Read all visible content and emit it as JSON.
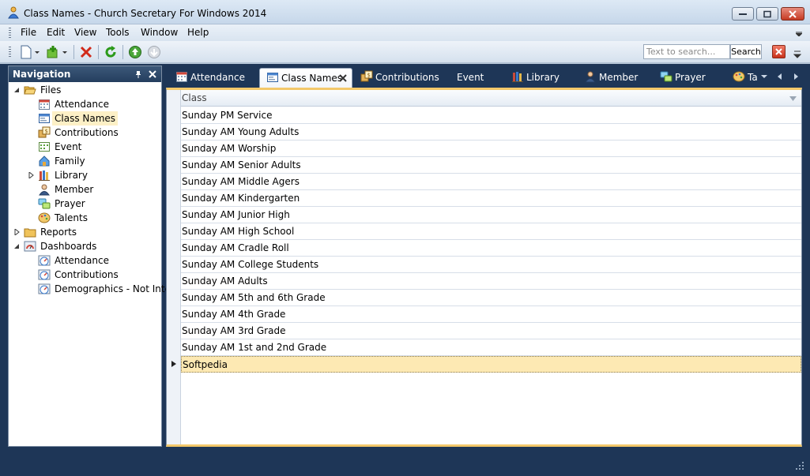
{
  "window": {
    "title": "Class Names - Church Secretary For Windows 2014"
  },
  "menu": {
    "items": [
      "File",
      "Edit",
      "View",
      "Tools",
      "Window",
      "Help"
    ]
  },
  "toolbar": {
    "buttons": [
      "new-icon",
      "add-icon",
      "delete-icon",
      "refresh-icon",
      "up-icon",
      "disabled-icon"
    ]
  },
  "search": {
    "placeholder": "Text to search...",
    "button_label": "Search"
  },
  "navigation": {
    "title": "Navigation",
    "nodes": [
      {
        "label": "Files",
        "icon": "folder-open-icon",
        "level": 0,
        "expanded": true
      },
      {
        "label": "Attendance",
        "icon": "calendar-icon",
        "level": 1
      },
      {
        "label": "Class Names",
        "icon": "class-icon",
        "level": 1,
        "selected": true
      },
      {
        "label": "Contributions",
        "icon": "contributions-icon",
        "level": 1
      },
      {
        "label": "Event",
        "icon": "event-icon",
        "level": 1
      },
      {
        "label": "Family",
        "icon": "family-icon",
        "level": 1
      },
      {
        "label": "Library",
        "icon": "library-icon",
        "level": 1,
        "expandable": true
      },
      {
        "label": "Member",
        "icon": "member-icon",
        "level": 1
      },
      {
        "label": "Prayer",
        "icon": "prayer-icon",
        "level": 1
      },
      {
        "label": "Talents",
        "icon": "talents-icon",
        "level": 1
      },
      {
        "label": "Reports",
        "icon": "folder-icon",
        "level": 0,
        "expandable": true
      },
      {
        "label": "Dashboards",
        "icon": "dashboard-icon",
        "level": 0,
        "expanded": true
      },
      {
        "label": "Attendance",
        "icon": "gauge-icon",
        "level": 1
      },
      {
        "label": "Contributions",
        "icon": "gauge-icon",
        "level": 1
      },
      {
        "label": "Demographics - Not Inter…",
        "icon": "gauge-icon",
        "level": 1
      }
    ]
  },
  "tabs": [
    {
      "label": "Attendance",
      "icon": "calendar-icon"
    },
    {
      "label": "Class Names",
      "icon": "class-icon",
      "active": true
    },
    {
      "label": "Contributions",
      "icon": "contributions-icon"
    },
    {
      "label": "Event",
      "icon": ""
    },
    {
      "label": "Library",
      "icon": "library-icon"
    },
    {
      "label": "Member",
      "icon": "member-icon"
    },
    {
      "label": "Prayer",
      "icon": "prayer-icon"
    },
    {
      "label": "Ta",
      "icon": "talents-icon"
    }
  ],
  "grid": {
    "column_header": "Class",
    "rows": [
      "Sunday PM Service",
      "Sunday AM Young Adults",
      "Sunday AM Worship",
      "Sunday AM Senior Adults",
      "Sunday AM Middle Agers",
      "Sunday AM Kindergarten",
      "Sunday AM Junior High",
      "Sunday AM High School",
      "Sunday AM Cradle Roll",
      "Sunday AM College Students",
      "Sunday AM Adults",
      "Sunday AM 5th and 6th Grade",
      "Sunday AM 4th Grade",
      "Sunday AM 3rd Grade",
      "Sunday AM 1st and 2nd Grade",
      "Softpedia"
    ],
    "focused_row": 15
  },
  "colors": {
    "workspace": "#1e3657",
    "accent": "#f3c86a",
    "selection": "#fde9b3"
  }
}
